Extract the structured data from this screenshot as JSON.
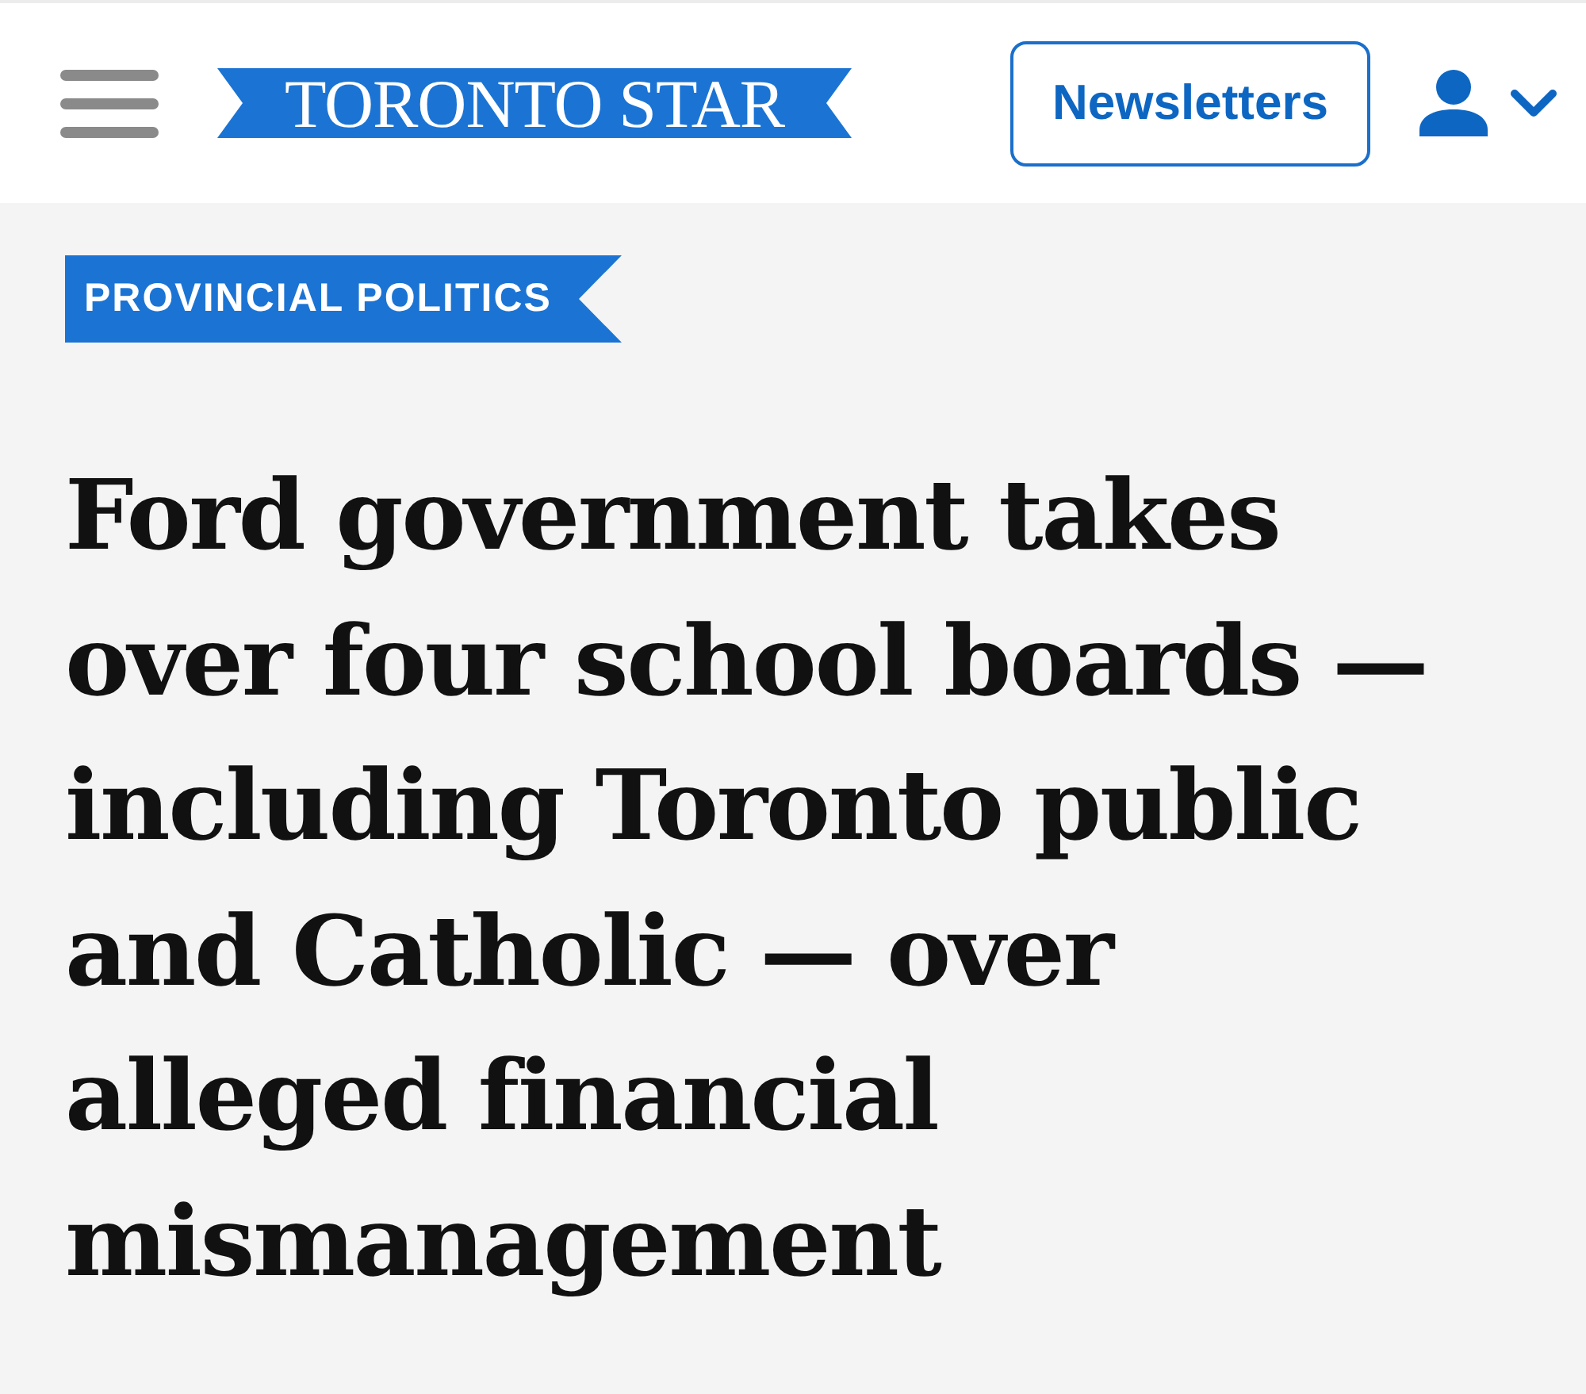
{
  "header": {
    "logo": "TORONTO STAR",
    "newsletters_button": "Newsletters"
  },
  "article": {
    "section_tag": "PROVINCIAL POLITICS",
    "headline": "Ford government takes over four school boards — including Toronto public and Catholic — over alleged financial mismanagement"
  }
}
